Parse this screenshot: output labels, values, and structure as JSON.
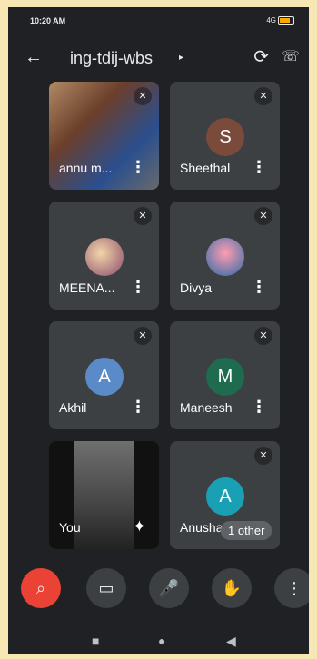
{
  "status": {
    "time": "10:20 AM",
    "network": "4G"
  },
  "header": {
    "meeting_code": "ing-tdij-wbs"
  },
  "tiles": [
    {
      "name": "annu m..."
    },
    {
      "name": "Sheethal",
      "initial": "S",
      "color": "#7a4b3a"
    },
    {
      "name": "MEENA..."
    },
    {
      "name": "Divya"
    },
    {
      "name": "Akhil",
      "initial": "A",
      "color": "#5b8ac9"
    },
    {
      "name": "Maneesh",
      "initial": "M",
      "color": "#1e6b4f"
    },
    {
      "name": "You"
    },
    {
      "name": "Anusha",
      "initial": "A",
      "color": "#1aa0b5",
      "others_label": "1 other"
    }
  ],
  "icons": {
    "back": "arrow-left-icon",
    "switch_camera": "switch-camera-icon",
    "audio_output": "audio-output-icon",
    "muted_mic": "mic-off-icon",
    "more": "more-vert-icon",
    "end_call": "end-call-icon",
    "camera": "video-camera-icon",
    "mic": "mic-icon",
    "raise_hand": "raise-hand-icon"
  }
}
